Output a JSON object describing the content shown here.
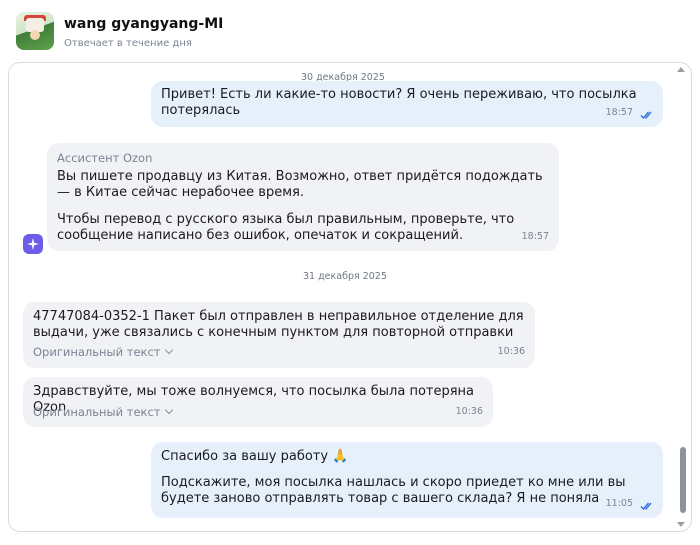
{
  "header": {
    "name": "wang gyangyang-MI",
    "status": "Отвечает в течение дня"
  },
  "chat": {
    "dates": [
      "30 декабря 2025",
      "31 декабря 2025"
    ],
    "messages": [
      {
        "text": "Привет! Есть ли какие-то новости? Я очень переживаю, что посылка потерялась",
        "time": "18:57"
      },
      {
        "sender": "Ассистент Ozon",
        "p1": "Вы пишете продавцу из Китая. Возможно, ответ придётся подождать — в Китае сейчас нерабочее время.",
        "p2": "Чтобы перевод с русского языка был правильным, проверьте, что сообщение написано без ошибок, опечаток и сокращений.",
        "time": "18:57"
      },
      {
        "text": "47747084-0352-1 Пакет был отправлен в неправильное отделение для выдачи, уже связались с конечным пунктом для повторной отправки",
        "original_label": "Оригинальный текст",
        "time": "10:36"
      },
      {
        "text": "Здравствуйте, мы тоже волнуемся, что посылка была потеряна Ozon",
        "original_label": "Оригинальный текст",
        "time": "10:36"
      },
      {
        "p1": "Спасибо за вашу работу 🙏",
        "p2": "Подскажите, моя посылка нашлась и скоро приедет ко мне или вы будете заново отправлять товар с вашего склада? Я не поняла",
        "time": "11:05"
      }
    ]
  },
  "colors": {
    "outgoing_bubble": "#e6f0fb",
    "incoming_bubble": "#f1f2f5",
    "read_ticks": "#2f6fdc",
    "assistant_icon": "#6c5ce7"
  },
  "icons": [
    "double-check-icon",
    "sparkle-icon",
    "chevron-down-icon"
  ]
}
